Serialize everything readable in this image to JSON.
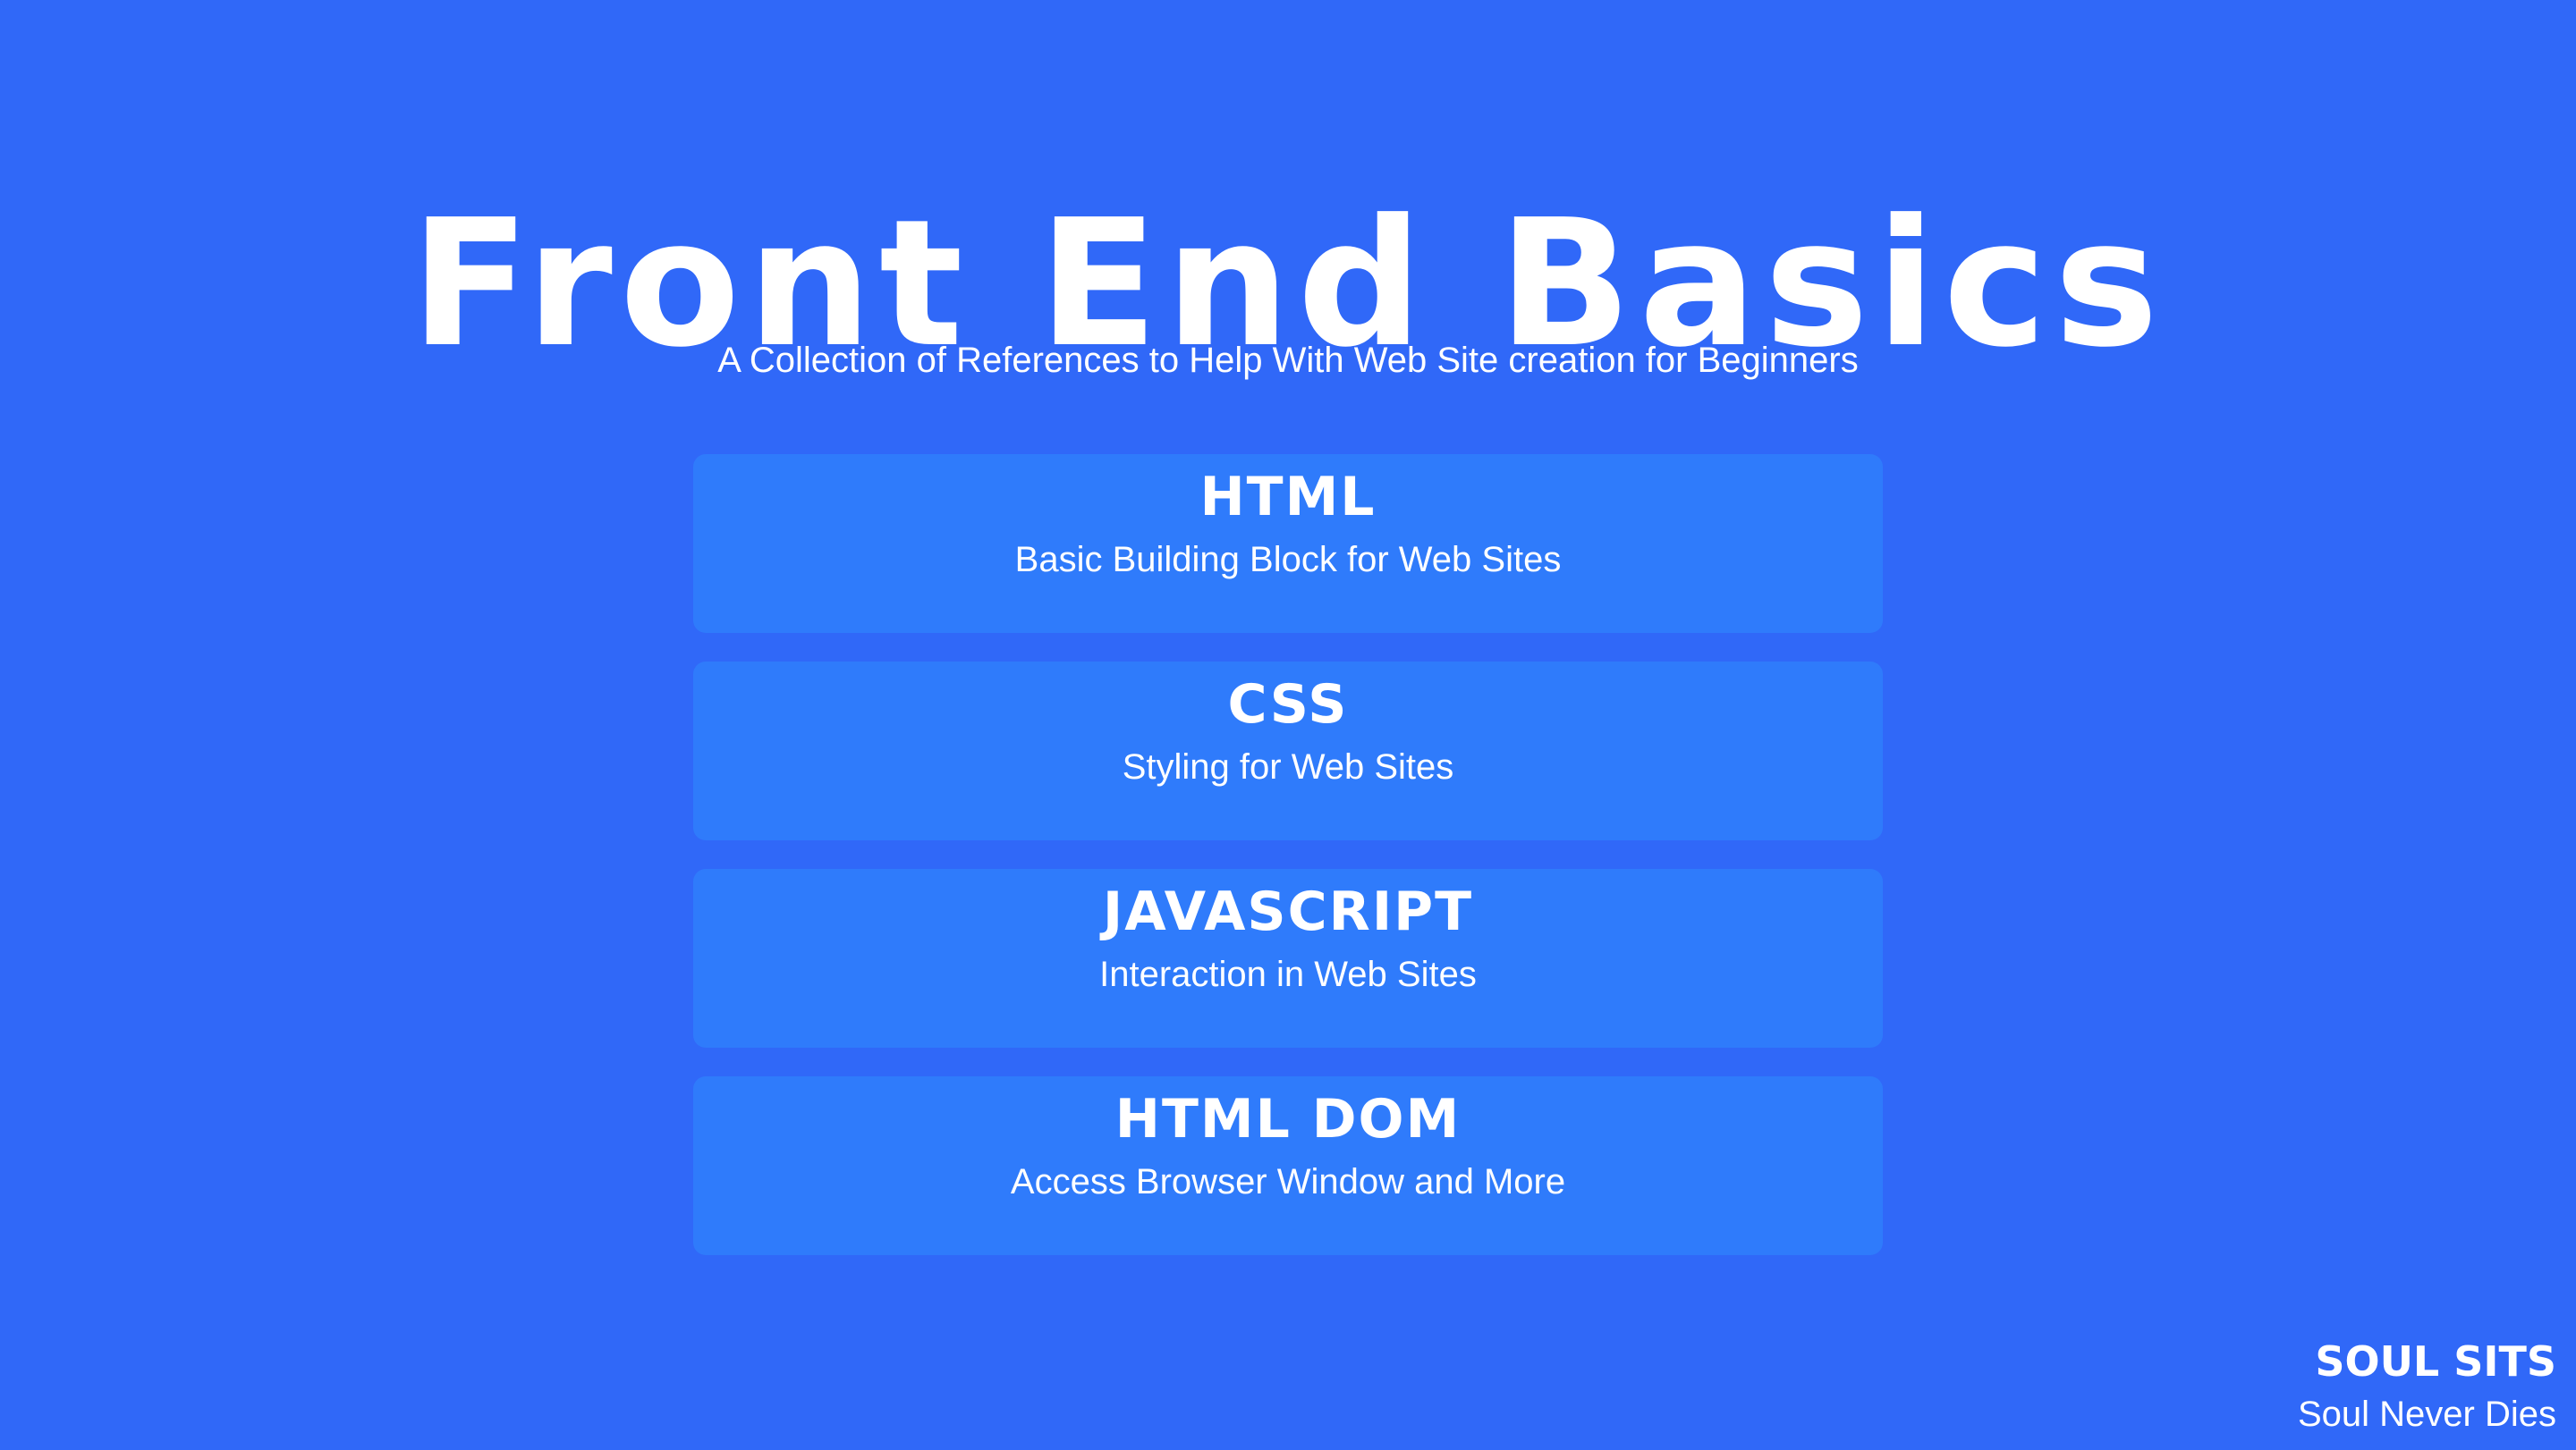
{
  "header": {
    "title": "Front End Basics",
    "subtitle": "A Collection of References to Help With Web Site creation for Beginners"
  },
  "cards": [
    {
      "title": "HTML",
      "description": "Basic Building Block for Web Sites"
    },
    {
      "title": "CSS",
      "description": "Styling for Web Sites"
    },
    {
      "title": "JAVASCRIPT",
      "description": "Interaction in Web Sites"
    },
    {
      "title": "HTML DOM",
      "description": "Access Browser Window and More"
    }
  ],
  "footer": {
    "brand": "SOUL SITS",
    "tagline": "Soul Never Dies"
  },
  "colors": {
    "background": "#3068f8",
    "card_background": "#2f7bfb",
    "text": "#ffffff"
  }
}
